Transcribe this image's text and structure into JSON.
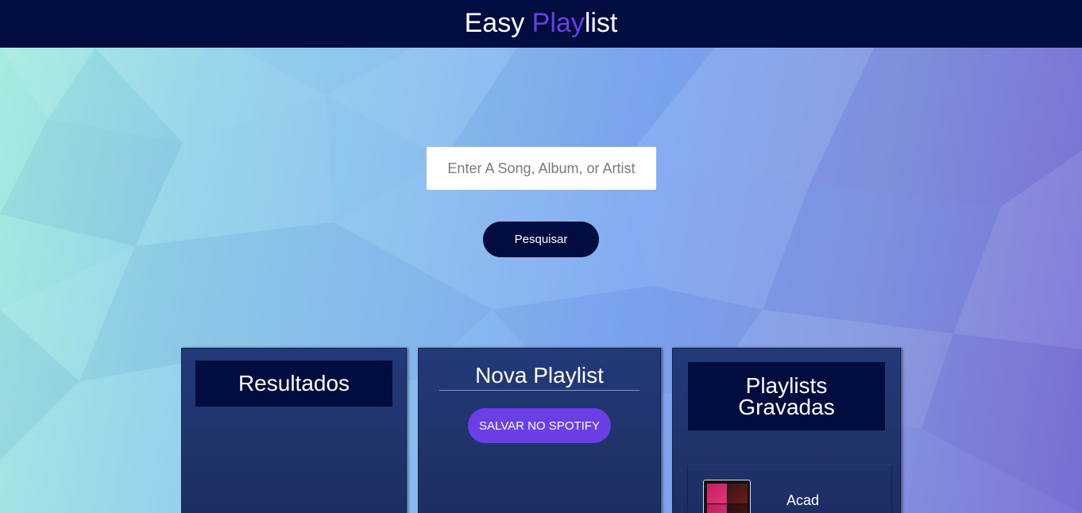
{
  "header": {
    "title_part1": "Easy ",
    "title_accent": "Play",
    "title_part2": "list",
    "background_color": "#010c3f",
    "accent_color": "#6a3fe6"
  },
  "search": {
    "placeholder": "Enter A Song, Album, or Artist",
    "value": "",
    "button_label": "Pesquisar"
  },
  "panels": {
    "results": {
      "heading": "Resultados"
    },
    "new_playlist": {
      "title": "Nova Playlist",
      "save_button_label": "SALVAR NO SPOTIFY",
      "button_color": "#6a3fe6"
    },
    "saved": {
      "heading_line1": "Playlists",
      "heading_line2": "Gravadas",
      "items": [
        {
          "name": "Acad",
          "cover_icon": "album-collage-icon"
        }
      ]
    }
  }
}
